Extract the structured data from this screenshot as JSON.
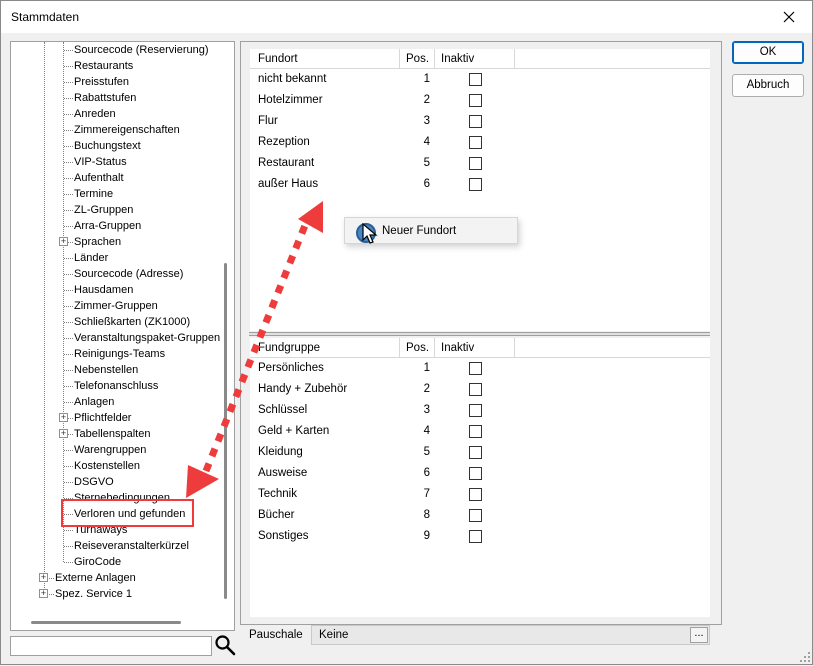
{
  "window": {
    "title": "Stammdaten"
  },
  "tree": {
    "items": [
      {
        "label": "Sourcecode (Reservierung)",
        "expandable": false
      },
      {
        "label": "Restaurants",
        "expandable": false
      },
      {
        "label": "Preisstufen",
        "expandable": false
      },
      {
        "label": "Rabattstufen",
        "expandable": false
      },
      {
        "label": "Anreden",
        "expandable": false
      },
      {
        "label": "Zimmereigenschaften",
        "expandable": false
      },
      {
        "label": "Buchungstext",
        "expandable": false
      },
      {
        "label": "VIP-Status",
        "expandable": false
      },
      {
        "label": "Aufenthalt",
        "expandable": false
      },
      {
        "label": "Termine",
        "expandable": false
      },
      {
        "label": "ZL-Gruppen",
        "expandable": false
      },
      {
        "label": "Arra-Gruppen",
        "expandable": false
      },
      {
        "label": "Sprachen",
        "expandable": true
      },
      {
        "label": "Länder",
        "expandable": false
      },
      {
        "label": "Sourcecode (Adresse)",
        "expandable": false
      },
      {
        "label": "Hausdamen",
        "expandable": false
      },
      {
        "label": "Zimmer-Gruppen",
        "expandable": false
      },
      {
        "label": "Schließkarten (ZK1000)",
        "expandable": false
      },
      {
        "label": "Veranstaltungspaket-Gruppen",
        "expandable": false
      },
      {
        "label": "Reinigungs-Teams",
        "expandable": false
      },
      {
        "label": "Nebenstellen",
        "expandable": false
      },
      {
        "label": "Telefonanschluss",
        "expandable": false
      },
      {
        "label": "Anlagen",
        "expandable": false
      },
      {
        "label": "Pflichtfelder",
        "expandable": true
      },
      {
        "label": "Tabellenspalten",
        "expandable": true
      },
      {
        "label": "Warengruppen",
        "expandable": false
      },
      {
        "label": "Kostenstellen",
        "expandable": false
      },
      {
        "label": "DSGVO",
        "expandable": false
      },
      {
        "label": "Sternebedingungen",
        "expandable": false
      },
      {
        "label": "Verloren und gefunden",
        "expandable": false
      },
      {
        "label": "Turnaways",
        "expandable": false
      },
      {
        "label": "Reiseveranstalterkürzel",
        "expandable": false
      },
      {
        "label": "GiroCode",
        "expandable": false
      }
    ],
    "root_items": [
      {
        "label": "Externe Anlagen"
      },
      {
        "label": "Spez. Service 1"
      }
    ],
    "search_value": ""
  },
  "fundort_grid": {
    "headers": {
      "name": "Fundort",
      "pos": "Pos.",
      "inaktiv": "Inaktiv"
    },
    "rows": [
      {
        "name": "nicht bekannt",
        "pos": "1",
        "inaktiv": false
      },
      {
        "name": "Hotelzimmer",
        "pos": "2",
        "inaktiv": false
      },
      {
        "name": "Flur",
        "pos": "3",
        "inaktiv": false
      },
      {
        "name": "Rezeption",
        "pos": "4",
        "inaktiv": false
      },
      {
        "name": "Restaurant",
        "pos": "5",
        "inaktiv": false
      },
      {
        "name": "außer Haus",
        "pos": "6",
        "inaktiv": false
      }
    ]
  },
  "fundgruppe_grid": {
    "headers": {
      "name": "Fundgruppe",
      "pos": "Pos.",
      "inaktiv": "Inaktiv"
    },
    "rows": [
      {
        "name": "Persönliches",
        "pos": "1",
        "inaktiv": false
      },
      {
        "name": "Handy + Zubehör",
        "pos": "2",
        "inaktiv": false
      },
      {
        "name": "Schlüssel",
        "pos": "3",
        "inaktiv": false
      },
      {
        "name": "Geld + Karten",
        "pos": "4",
        "inaktiv": false
      },
      {
        "name": "Kleidung",
        "pos": "5",
        "inaktiv": false
      },
      {
        "name": "Ausweise",
        "pos": "6",
        "inaktiv": false
      },
      {
        "name": "Technik",
        "pos": "7",
        "inaktiv": false
      },
      {
        "name": "Bücher",
        "pos": "8",
        "inaktiv": false
      },
      {
        "name": "Sonstiges",
        "pos": "9",
        "inaktiv": false
      }
    ]
  },
  "context_menu": {
    "item": "Neuer Fundort"
  },
  "footer": {
    "label": "Pauschale",
    "value": "Keine",
    "browse": "..."
  },
  "buttons": {
    "ok": "OK",
    "cancel": "Abbruch"
  },
  "colors": {
    "annotation_red": "#ee3b3b",
    "focus_blue": "#0067c0"
  }
}
